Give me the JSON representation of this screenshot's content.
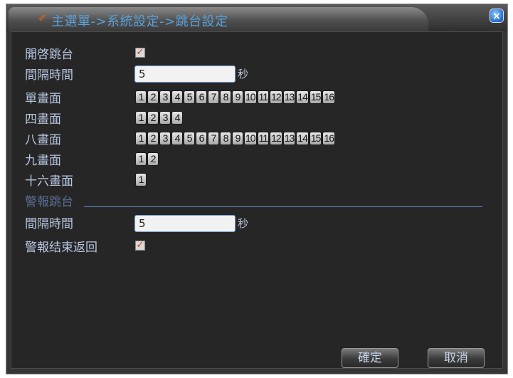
{
  "window": {
    "title": "主選單->系統設定->跳台設定",
    "title_icon": "pencil-icon",
    "close_label": "×"
  },
  "settings": {
    "enable_sequence_label": "開啓跳台",
    "enable_sequence_checked": true,
    "interval_label": "間隔時間",
    "interval_value": "5",
    "interval_unit": "秒"
  },
  "layouts": [
    {
      "label": "單畫面",
      "channels": [
        "1",
        "2",
        "3",
        "4",
        "5",
        "6",
        "7",
        "8",
        "9",
        "10",
        "11",
        "12",
        "13",
        "14",
        "15",
        "16"
      ]
    },
    {
      "label": "四畫面",
      "channels": [
        "1",
        "2",
        "3",
        "4"
      ]
    },
    {
      "label": "八畫面",
      "channels": [
        "1",
        "2",
        "3",
        "4",
        "5",
        "6",
        "7",
        "8",
        "9",
        "10",
        "11",
        "12",
        "13",
        "14",
        "15",
        "16"
      ]
    },
    {
      "label": "九畫面",
      "channels": [
        "1",
        "2"
      ]
    },
    {
      "label": "十六畫面",
      "channels": [
        "1"
      ]
    }
  ],
  "alarm": {
    "section_label": "警報跳台",
    "interval_label": "間隔時間",
    "interval_value": "5",
    "interval_unit": "秒",
    "return_label": "警報结束返回",
    "return_checked": true
  },
  "buttons": {
    "ok_label": "確定",
    "cancel_label": "取消"
  },
  "colors": {
    "title_text": "#5aa0d8",
    "label_text": "#b8c6e2",
    "check_mark": "#d04010",
    "field_border": "#6fa0d8"
  }
}
